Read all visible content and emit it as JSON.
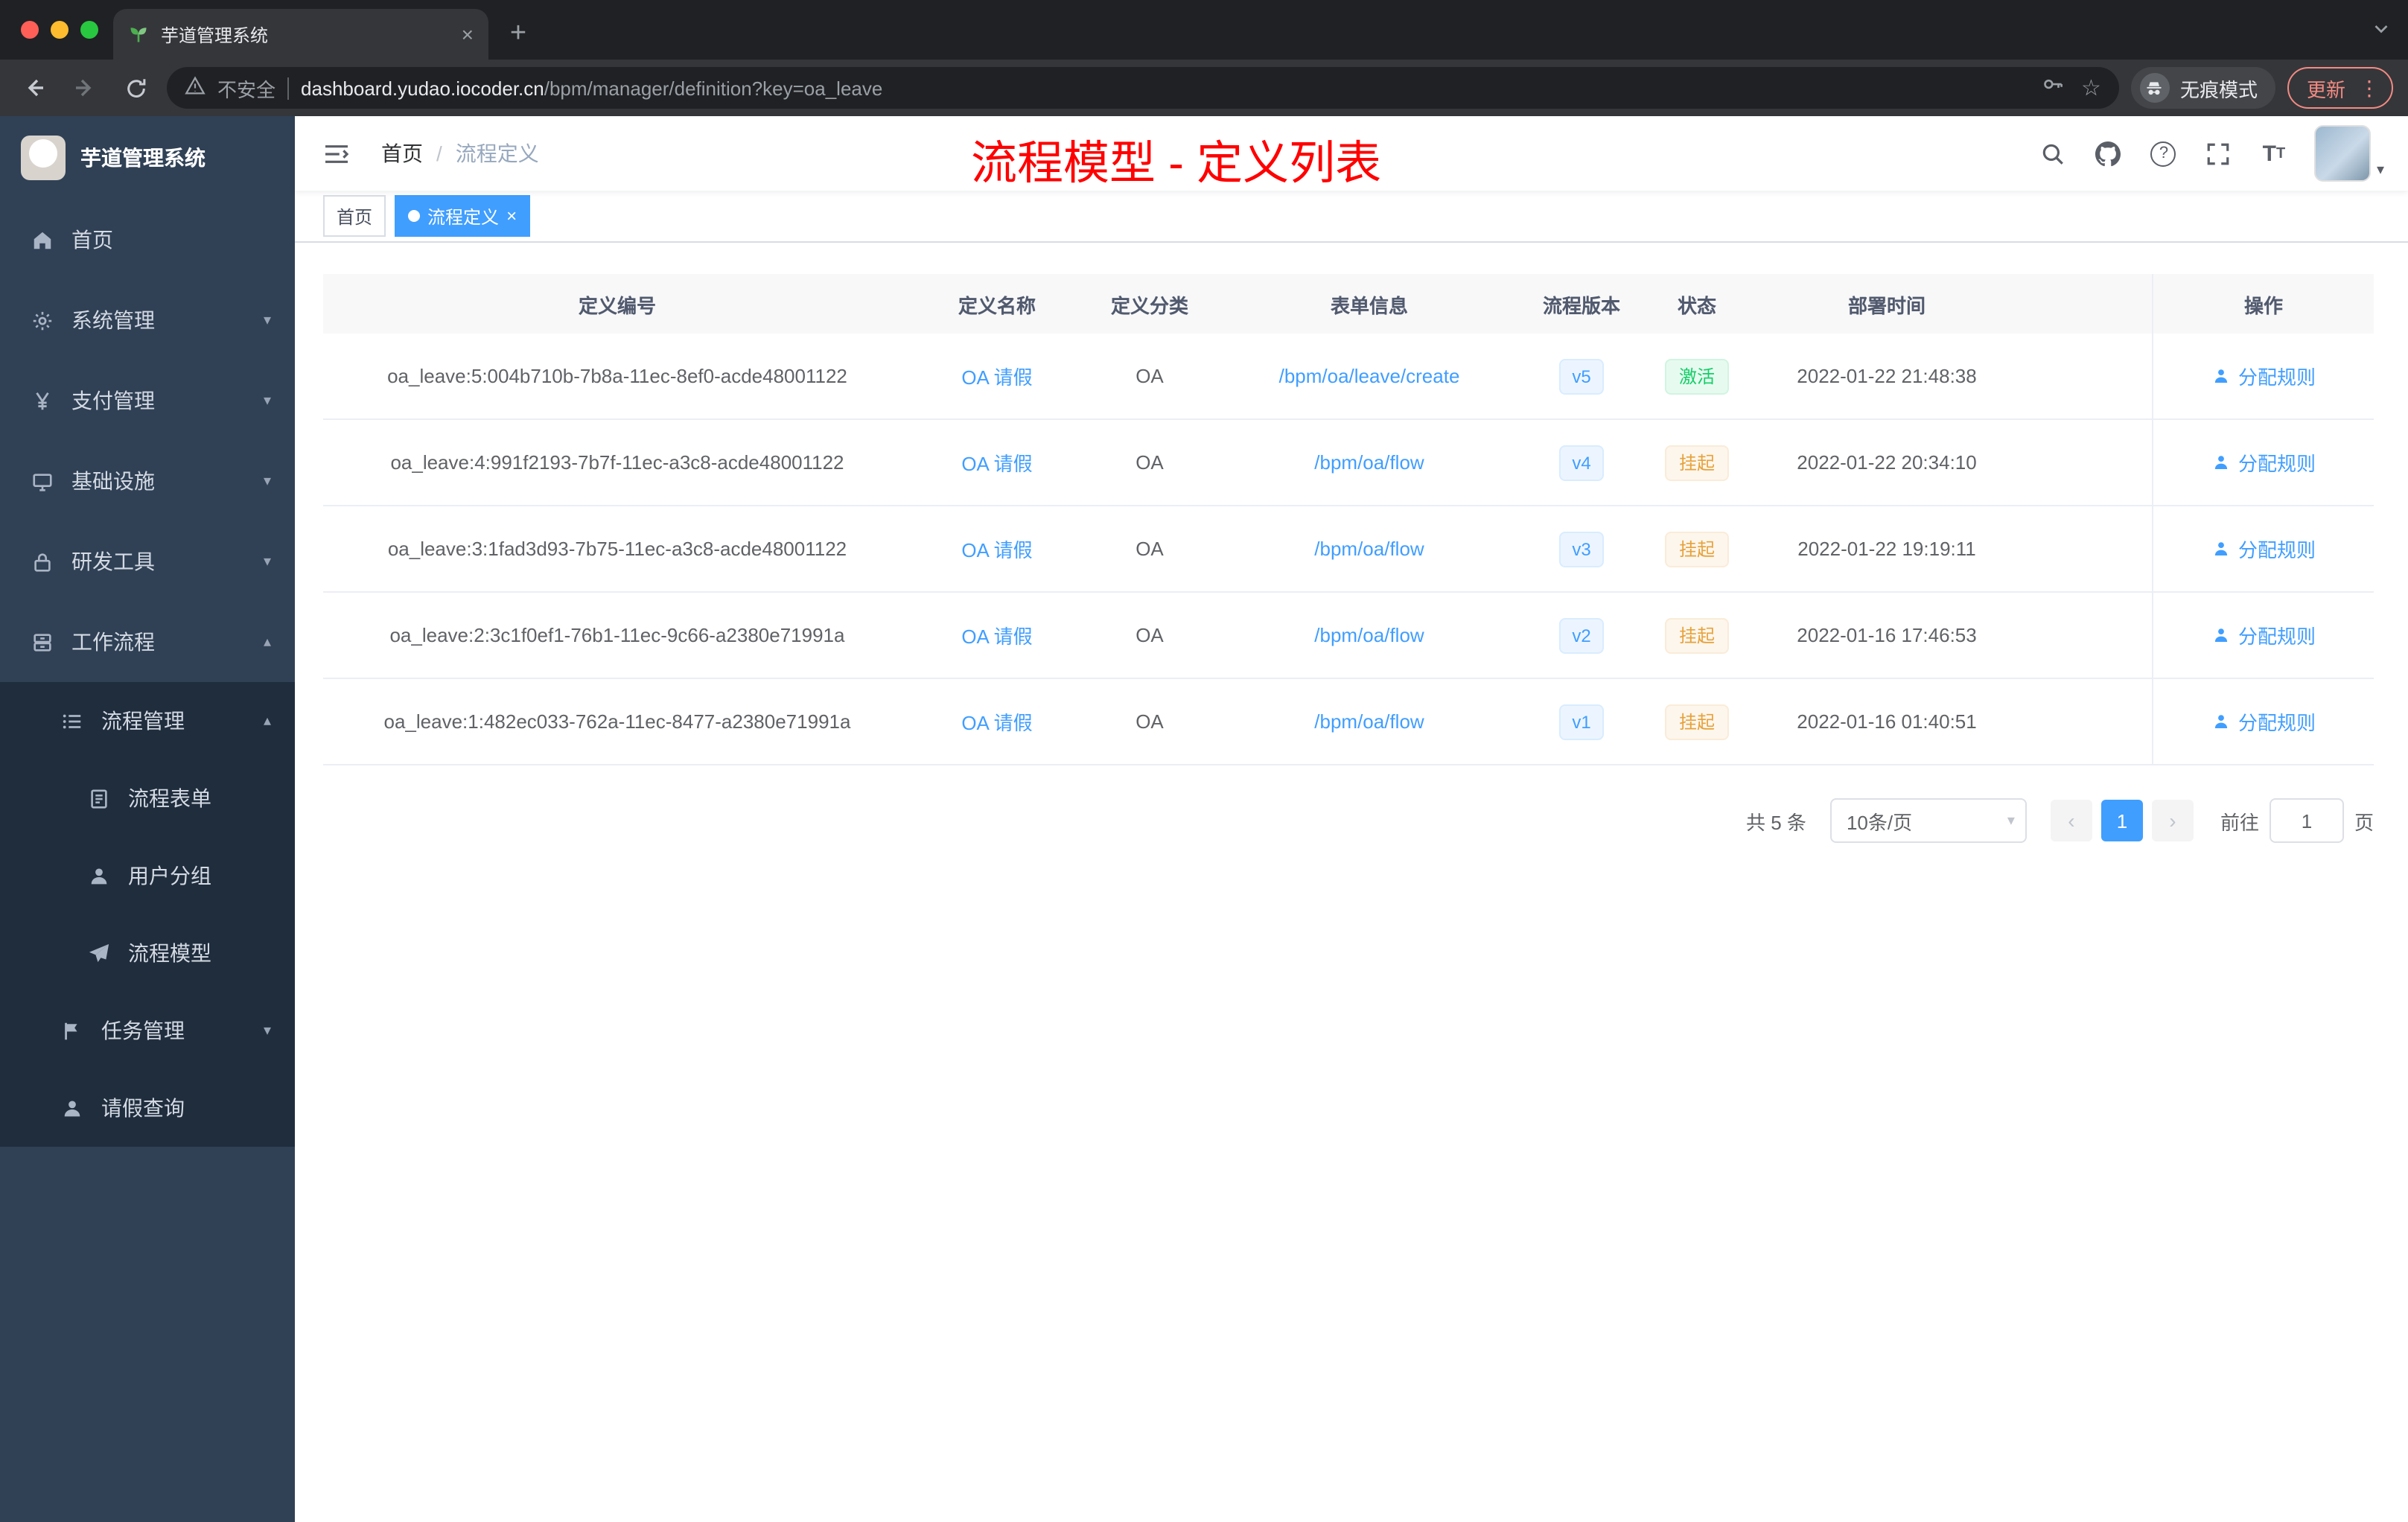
{
  "browser": {
    "tab_title": "芋道管理系统",
    "new_tab_label": "+",
    "security_label": "不安全",
    "url_host": "dashboard.yudao.iocoder.cn",
    "url_path": "/bpm/manager/definition?key=oa_leave",
    "incognito_label": "无痕模式",
    "update_label": "更新"
  },
  "sidebar": {
    "app_title": "芋道管理系统",
    "items": [
      {
        "label": "首页"
      },
      {
        "label": "系统管理"
      },
      {
        "label": "支付管理"
      },
      {
        "label": "基础设施"
      },
      {
        "label": "研发工具"
      },
      {
        "label": "工作流程"
      },
      {
        "label": "流程管理"
      },
      {
        "label": "流程表单"
      },
      {
        "label": "用户分组"
      },
      {
        "label": "流程模型"
      },
      {
        "label": "任务管理"
      },
      {
        "label": "请假查询"
      }
    ]
  },
  "header": {
    "breadcrumb_home": "首页",
    "breadcrumb_separator": "/",
    "breadcrumb_current": "流程定义",
    "annotation": "流程模型 - 定义列表"
  },
  "tags": [
    {
      "label": "首页"
    },
    {
      "label": "流程定义",
      "close": "×"
    }
  ],
  "table": {
    "columns": [
      "定义编号",
      "定义名称",
      "定义分类",
      "表单信息",
      "流程版本",
      "状态",
      "部署时间",
      "操作"
    ],
    "rows": [
      {
        "id": "oa_leave:5:004b710b-7b8a-11ec-8ef0-acde48001122",
        "name": "OA 请假",
        "category": "OA",
        "form": "/bpm/oa/leave/create",
        "version": "v5",
        "status": "激活",
        "status_type": "success",
        "deploy_time": "2022-01-22 21:48:38",
        "action": "分配规则"
      },
      {
        "id": "oa_leave:4:991f2193-7b7f-11ec-a3c8-acde48001122",
        "name": "OA 请假",
        "category": "OA",
        "form": "/bpm/oa/flow",
        "version": "v4",
        "status": "挂起",
        "status_type": "warning",
        "deploy_time": "2022-01-22 20:34:10",
        "action": "分配规则"
      },
      {
        "id": "oa_leave:3:1fad3d93-7b75-11ec-a3c8-acde48001122",
        "name": "OA 请假",
        "category": "OA",
        "form": "/bpm/oa/flow",
        "version": "v3",
        "status": "挂起",
        "status_type": "warning",
        "deploy_time": "2022-01-22 19:19:11",
        "action": "分配规则"
      },
      {
        "id": "oa_leave:2:3c1f0ef1-76b1-11ec-9c66-a2380e71991a",
        "name": "OA 请假",
        "category": "OA",
        "form": "/bpm/oa/flow",
        "version": "v2",
        "status": "挂起",
        "status_type": "warning",
        "deploy_time": "2022-01-16 17:46:53",
        "action": "分配规则"
      },
      {
        "id": "oa_leave:1:482ec033-762a-11ec-8477-a2380e71991a",
        "name": "OA 请假",
        "category": "OA",
        "form": "/bpm/oa/flow",
        "version": "v1",
        "status": "挂起",
        "status_type": "warning",
        "deploy_time": "2022-01-16 01:40:51",
        "action": "分配规则"
      }
    ]
  },
  "pagination": {
    "total": "共 5 条",
    "page_size": "10条/页",
    "prev": "‹",
    "current_page": "1",
    "next": "›",
    "goto_label": "前往",
    "goto_value": "1",
    "page_unit": "页"
  },
  "colors": {
    "accent": "#409eff",
    "sidebar_bg": "#304156",
    "submenu_bg": "#1f2d3d",
    "status_active": "#13ce66",
    "status_suspended": "#e6a23c",
    "annotation_red": "#ff0000",
    "update_red": "#f28b82"
  }
}
